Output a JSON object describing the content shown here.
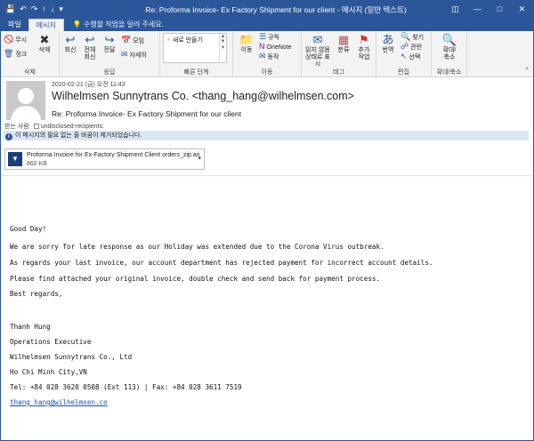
{
  "window": {
    "title": "Re: Proforma Invoice- Ex Factory Shipment for our client - 메시지 (일반 텍스트)",
    "quick_access": [
      "save-icon",
      "undo-icon",
      "redo-icon",
      "up-icon",
      "down-icon"
    ],
    "controls": [
      "restore-down-icon",
      "minimize-icon",
      "maximize-icon",
      "close-icon"
    ]
  },
  "tabs": {
    "file": "파일",
    "message": "메시지",
    "tell_me": "수행할 작업을 알려 주세요."
  },
  "ribbon": {
    "delete_group": {
      "ignore": "무시",
      "junk": "정크",
      "delete": "삭제",
      "label": "삭제"
    },
    "respond_group": {
      "reply": "회신",
      "reply_all_1": "전체",
      "reply_all_2": "회신",
      "forward": "전달",
      "meeting": "모임",
      "more": "자세히",
      "label": "응답"
    },
    "quick_steps": {
      "item": "새로 만들기",
      "label": "빠른 단계"
    },
    "move_group": {
      "move": "이동",
      "rules": "규칙",
      "onenote": "OneNote",
      "actions": "동작",
      "label": "이동"
    },
    "tags_group": {
      "read_1": "읽지 않음",
      "read_2": "상태로 표시",
      "categorize": "분류",
      "followup_1": "추가",
      "followup_2": "작업",
      "label": "태그"
    },
    "editing_group": {
      "translate": "번역",
      "find": "찾기",
      "related": "관련",
      "select": "선택",
      "label": "편집"
    },
    "zoom_group": {
      "zoom_1": "확대/",
      "zoom_2": "축소",
      "label": "확대/축소"
    }
  },
  "header": {
    "date": "2020-02-21 (금) 오전 11:43",
    "sender": "Wilhelmsen Sunnytrans Co. <thang_hang@wilhelmsen.com>",
    "subject": "Re: Proforma Invoice- Ex Factory Shipment for our client",
    "to_label": "받는 사람",
    "to_value": "undisclosed-recipients:",
    "info": "이 메시지의 필요 없는 줄 바꿈이 제거되었습니다."
  },
  "attachment": {
    "name": "Proforma Invoice for Ex-Factory Shipment Client orders_zip.arj",
    "size": "860 KB"
  },
  "body": {
    "greeting": "Good Day!",
    "p1": "We are sorry for late response as our Holiday was extended due to the Corona Virus outbreak.",
    "p2": "As regards your last invoice, our account department has rejected payment for incorrect account details.",
    "p3": "Please find attached your original invoice, double check and send back for payment process.",
    "closing": "Best regards,",
    "sig_name": "Thanh Hung",
    "sig_title": "Operations Executive",
    "sig_company": "Wilhelmsen Sunnytrans Co., Ltd",
    "sig_city": "Ho Chi Minh City,VN",
    "sig_phone": "Tel: +84 028 3620 0508 (Ext 113) | Fax: +84 028 3611 7519",
    "sig_email": "thang_hang@wilhelmsen.co"
  }
}
